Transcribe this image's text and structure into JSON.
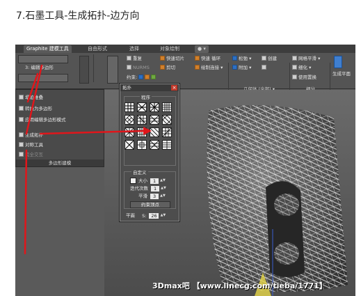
{
  "page": {
    "heading": "7.石墨工具-生成拓扑-边方向"
  },
  "ribbon": {
    "tabs": [
      "Graphite 建模工具",
      "自由形式",
      "选择",
      "对象绘制"
    ],
    "left_label": "3: 编辑多边形",
    "buttons": {
      "redo": "重复",
      "nurms": "NURMS",
      "fast_slice": "快速切片",
      "fast_loop": "快速 循环",
      "cut": "剪切",
      "paint_connect": "绘制连接",
      "relax": "松弛",
      "create": "创建",
      "attach": "附加",
      "mesh_smooth": "网格平滑",
      "refine": "细化",
      "use_displace": "使用置换",
      "generate_plane": "生成平面",
      "constraint": "约束:"
    },
    "footers": {
      "geometry": "几何体 (全部)",
      "subdivide": "细分"
    }
  },
  "dropdown": {
    "items": [
      "塌陷堆叠",
      "转换为多边形",
      "应用编辑多边形模式",
      "生成拓扑",
      "对称工具",
      "完全交互"
    ],
    "footer": "多边形建模"
  },
  "topology_panel": {
    "title": "拓扑",
    "section": "程序",
    "options": {
      "iterations_label": "迭代次数",
      "iterations_value": "1",
      "size_label": "大小",
      "size_value": "1",
      "smooth_label": "平滑",
      "smooth_value": "3",
      "custom_label": "自定义",
      "top_button": "约束顶点",
      "plane_label": "平面",
      "s_label": "S:",
      "s_value": "26"
    }
  },
  "watermark": "3Dmax吧 【www.linecg.com/tieba/1771】",
  "colors": {
    "annotation_red": "#e0161b",
    "ui_dark": "#4a4a4a",
    "mesh_white": "#ffffff"
  }
}
